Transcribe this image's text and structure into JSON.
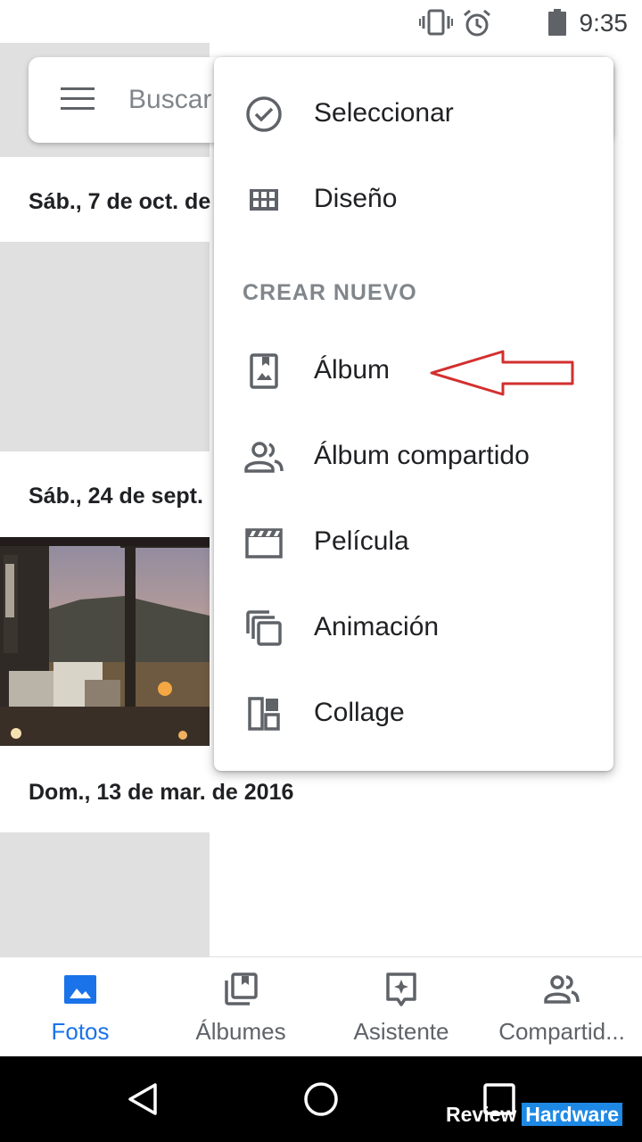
{
  "status_bar": {
    "time": "9:35",
    "icons": [
      "vibrate-icon",
      "alarm-icon",
      "battery-icon"
    ]
  },
  "search": {
    "placeholder": "Buscar"
  },
  "dates": [
    "Sáb., 7 de oct. de",
    "Sáb., 24 de sept.",
    "Dom., 13 de mar. de 2016"
  ],
  "menu": {
    "items_top": [
      {
        "label": "Seleccionar",
        "icon": "check-circle-icon"
      },
      {
        "label": "Diseño",
        "icon": "grid-icon"
      }
    ],
    "section_label": "CREAR NUEVO",
    "items_create": [
      {
        "label": "Álbum",
        "icon": "album-icon"
      },
      {
        "label": "Álbum compartido",
        "icon": "shared-album-icon"
      },
      {
        "label": "Película",
        "icon": "movie-icon"
      },
      {
        "label": "Animación",
        "icon": "animation-icon"
      },
      {
        "label": "Collage",
        "icon": "collage-icon"
      }
    ]
  },
  "bottom_nav": {
    "tabs": [
      {
        "label": "Fotos",
        "icon": "photo-icon",
        "active": true
      },
      {
        "label": "Álbumes",
        "icon": "albums-icon",
        "active": false
      },
      {
        "label": "Asistente",
        "icon": "assistant-icon",
        "active": false
      },
      {
        "label": "Compartid...",
        "icon": "sharing-icon",
        "active": false
      }
    ]
  },
  "watermark": {
    "part1": "Review",
    "part2": "Hardware"
  },
  "colors": {
    "accent": "#1a73e8",
    "arrow": "#d32f2f",
    "placeholder_gray": "#e0e0e0"
  }
}
